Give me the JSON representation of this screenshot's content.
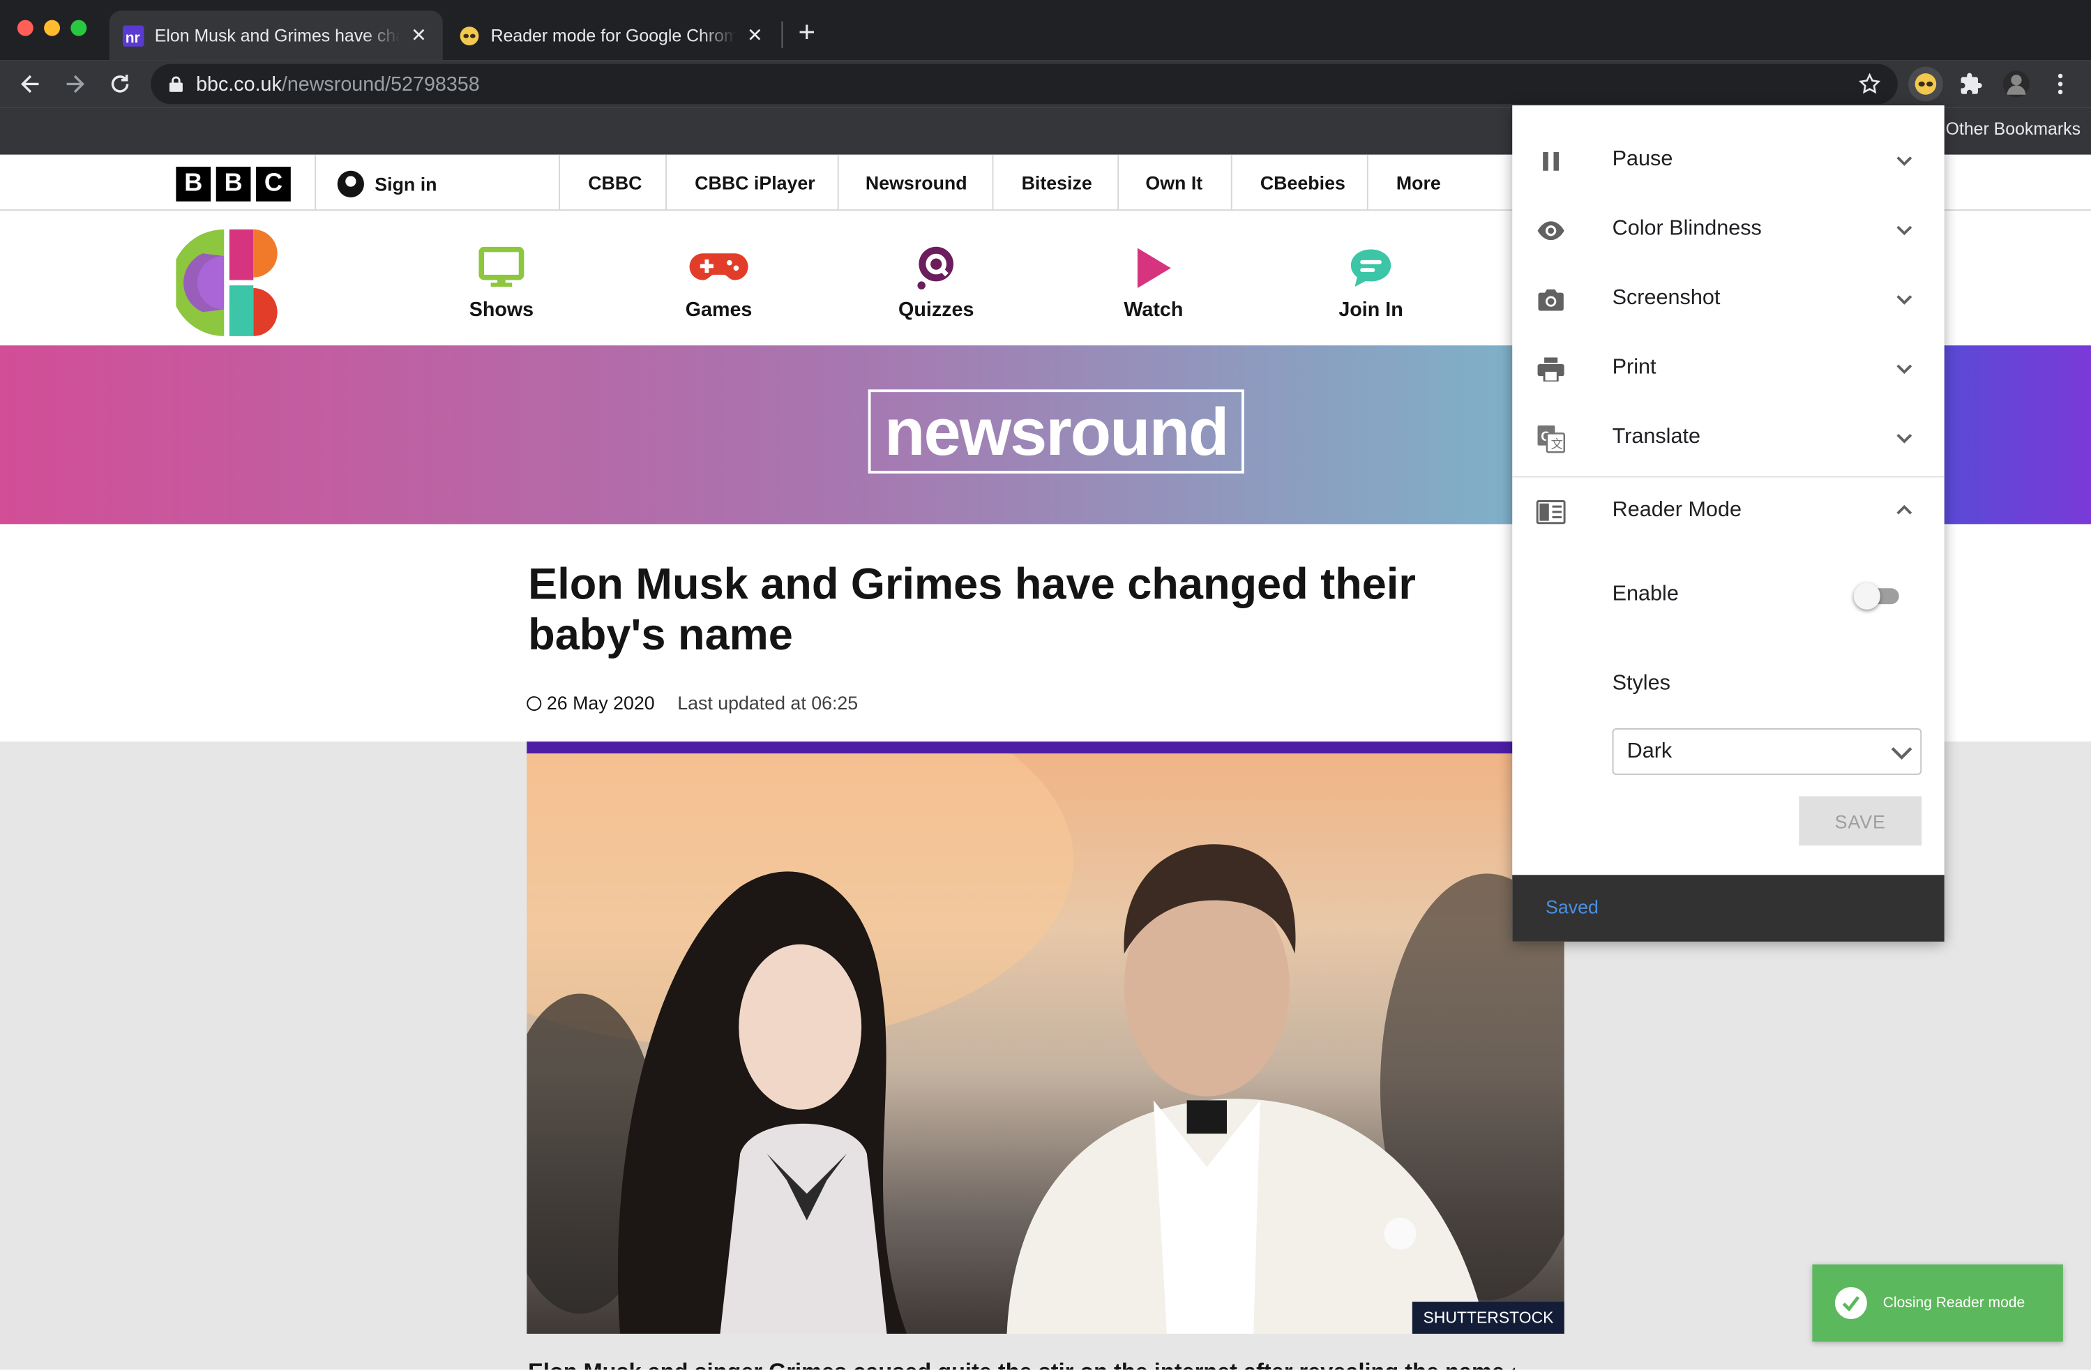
{
  "browser": {
    "tabs": [
      {
        "title": "Elon Musk and Grimes have changed their baby's name",
        "favicon": "newsround-favicon",
        "active": true
      },
      {
        "title": "Reader mode for Google Chrome",
        "favicon": "extension-favicon",
        "active": false
      }
    ],
    "url_host": "bbc.co.uk",
    "url_path": "/newsround/52798358",
    "bookmarks_other": "Other Bookmarks"
  },
  "bbc_bar": {
    "logo_letters": [
      "B",
      "B",
      "C"
    ],
    "sign_in": "Sign in",
    "nav": [
      "CBBC",
      "CBBC iPlayer",
      "Newsround",
      "Bitesize",
      "Own It",
      "CBeebies",
      "More"
    ]
  },
  "cbbc_nav": [
    {
      "label": "Shows",
      "icon": "tv-icon",
      "color": "#8dc63f"
    },
    {
      "label": "Games",
      "icon": "gamepad-icon",
      "color": "#e23d28"
    },
    {
      "label": "Quizzes",
      "icon": "quiz-icon",
      "color": "#6b1d5c"
    },
    {
      "label": "Watch",
      "icon": "play-icon",
      "color": "#d6347e"
    },
    {
      "label": "Join In",
      "icon": "chat-icon",
      "color": "#3cc6a7"
    }
  ],
  "banner": {
    "logo_text": "newsround"
  },
  "article": {
    "headline": "Elon Musk and Grimes have changed their baby's name",
    "date": "26 May 2020",
    "updated": "Last updated at 06:25",
    "image_credit": "SHUTTERSTOCK",
    "body_first_line": "Elon Musk and singer Grimes caused quite the stir on the internet after revealing the name of"
  },
  "popup": {
    "items": [
      {
        "label": "Pause",
        "icon": "pause-icon",
        "expanded": false
      },
      {
        "label": "Color Blindness",
        "icon": "eye-icon",
        "expanded": false
      },
      {
        "label": "Screenshot",
        "icon": "camera-icon",
        "expanded": false
      },
      {
        "label": "Print",
        "icon": "printer-icon",
        "expanded": false
      },
      {
        "label": "Translate",
        "icon": "translate-icon",
        "expanded": false
      },
      {
        "label": "Reader Mode",
        "icon": "reader-mode-icon",
        "expanded": true
      }
    ],
    "enable_label": "Enable",
    "enable_on": false,
    "styles_label": "Styles",
    "style_value": "Dark",
    "save_label": "SAVE",
    "snackbar": "Saved"
  },
  "toast": {
    "message": "Closing Reader mode",
    "color": "#5cb85c"
  },
  "colors": {
    "accent_purple": "#4c1ea6",
    "snackbar_link": "#4a90e2"
  }
}
